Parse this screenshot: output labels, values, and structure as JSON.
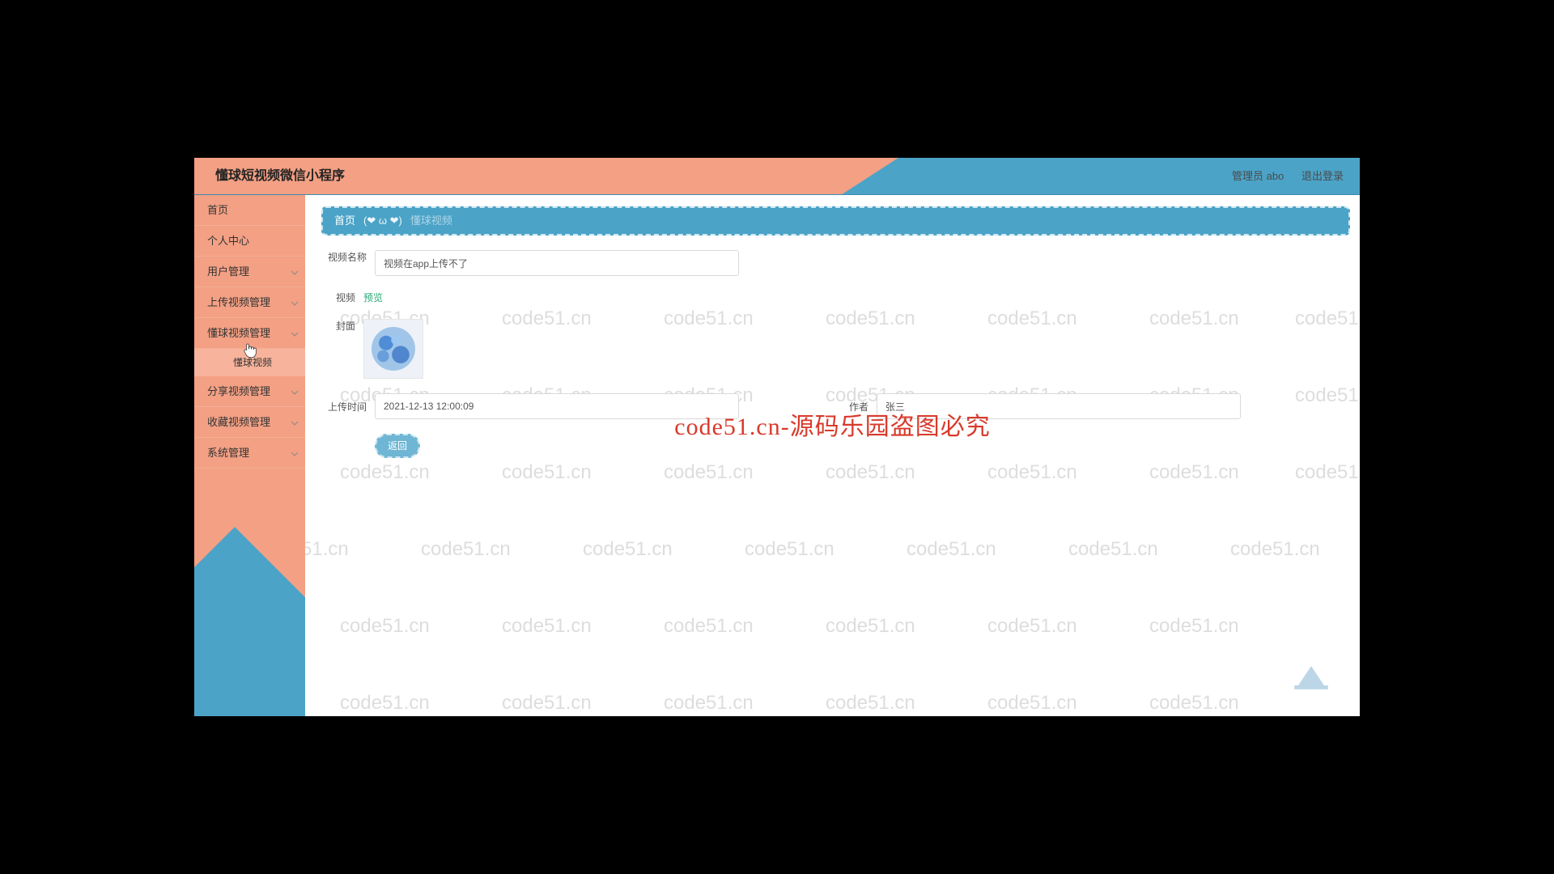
{
  "header": {
    "title": "懂球短视频微信小程序",
    "admin_label": "管理员 abo",
    "logout_label": "退出登录"
  },
  "sidebar": {
    "items": [
      {
        "label": "首页",
        "expandable": false
      },
      {
        "label": "个人中心",
        "expandable": false
      },
      {
        "label": "用户管理",
        "expandable": true
      },
      {
        "label": "上传视频管理",
        "expandable": true
      },
      {
        "label": "懂球视频管理",
        "expandable": true
      },
      {
        "label": "分享视频管理",
        "expandable": true
      },
      {
        "label": "收藏视频管理",
        "expandable": true
      },
      {
        "label": "系统管理",
        "expandable": true
      }
    ],
    "sub_item": "懂球视频"
  },
  "breadcrumb": {
    "home": "首页",
    "face": "(❤ ω ❤)",
    "current": "懂球视频"
  },
  "form": {
    "video_name_label": "视频名称",
    "video_name_value": "视频在app上传不了",
    "video_label": "视频",
    "preview_link": "预览",
    "cover_label": "封面",
    "upload_time_label": "上传时间",
    "upload_time_value": "2021-12-13 12:00:09",
    "author_label": "作者",
    "author_value": "张三",
    "back_button": "返回"
  },
  "watermark": {
    "text": "code51.cn",
    "center": "code51.cn-源码乐园盗图必究"
  }
}
